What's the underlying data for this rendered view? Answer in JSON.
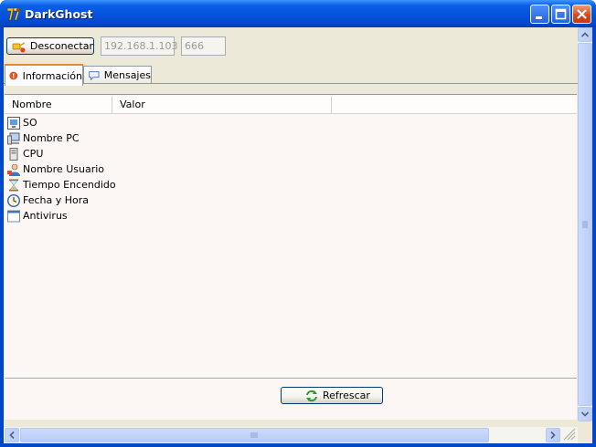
{
  "window": {
    "title": "DarkGhost",
    "app_icon": "fox-logo-icon",
    "controls": [
      "minimize-icon",
      "maximize-icon",
      "close-icon"
    ]
  },
  "toolbar": {
    "disconnect_label": "Desconectar",
    "ip_value": "192.168.1.103",
    "port_value": "666"
  },
  "tabs": [
    {
      "label": "Información",
      "icon": "info-icon",
      "active": true
    },
    {
      "label": "Mensajes",
      "icon": "speech-bubble-icon",
      "active": false
    }
  ],
  "listview": {
    "columns": [
      "Nombre",
      "Valor"
    ],
    "rows": [
      {
        "label": "SO",
        "icon": "os-icon",
        "value": ""
      },
      {
        "label": "Nombre PC",
        "icon": "computer-icon",
        "value": ""
      },
      {
        "label": "CPU",
        "icon": "cpu-icon",
        "value": ""
      },
      {
        "label": "Nombre Usuario",
        "icon": "user-icon",
        "value": ""
      },
      {
        "label": "Tiempo Encendido",
        "icon": "hourglass-icon",
        "value": ""
      },
      {
        "label": "Fecha y Hora",
        "icon": "clock-icon",
        "value": ""
      },
      {
        "label": "Antivirus",
        "icon": "window-icon",
        "value": ""
      }
    ]
  },
  "refresh_label": "Refrescar",
  "colors": {
    "titlebar": "#0550dc",
    "client_bg": "#ece9d8",
    "panel_bg": "#fcf6f5",
    "tab_accent": "#e68b2c"
  }
}
